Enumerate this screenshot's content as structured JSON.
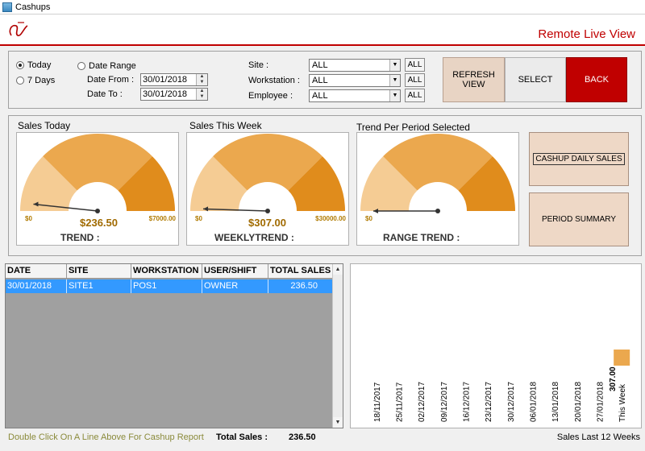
{
  "window": {
    "title": "Cashups"
  },
  "header": {
    "view_title": "Remote Live View"
  },
  "filters": {
    "today_label": "Today",
    "seven_days_label": "7 Days",
    "date_range_label": "Date Range",
    "date_from_label": "Date From :",
    "date_to_label": "Date To :",
    "date_from": "30/01/2018",
    "date_to": "30/01/2018",
    "site_label": "Site :",
    "workstation_label": "Workstation :",
    "employee_label": "Employee :",
    "site_value": "ALL",
    "workstation_value": "ALL",
    "employee_value": "ALL",
    "all_button": "ALL",
    "selected_period": "Today"
  },
  "actions": {
    "refresh_label": "REFRESH VIEW",
    "select_label": "SELECT",
    "back_label": "BACK",
    "back_color": "#c00000"
  },
  "gauges": [
    {
      "title": "Sales Today",
      "min": "$0",
      "max": "$7000.00",
      "value": "$236.50",
      "value_num": 236.5,
      "max_num": 7000,
      "trend": "TREND :"
    },
    {
      "title": "Sales This Week",
      "min": "$0",
      "max": "$30000.00",
      "value": "$307.00",
      "value_num": 307,
      "max_num": 30000,
      "trend": "WEEKLYTREND :"
    },
    {
      "title": "Trend Per Period Selected",
      "min": "$0",
      "max": "",
      "value": "",
      "value_num": 0,
      "max_num": 1,
      "trend": "RANGE TREND :"
    }
  ],
  "gauge_colors": {
    "light": "#f5cc94",
    "mid": "#eba84e",
    "dark": "#e08c1c"
  },
  "side_buttons": {
    "cashup_daily": "CASHUP DAILY SALES",
    "period_summary": "PERIOD SUMMARY"
  },
  "table": {
    "columns": [
      "DATE",
      "SITE",
      "WORKSTATION",
      "USER/SHIFT",
      "TOTAL SALES"
    ],
    "rows": [
      [
        "30/01/2018",
        "SITE1",
        "POS1",
        "OWNER",
        "236.50"
      ]
    ]
  },
  "footer": {
    "hint": "Double Click On A Line Above For Cashup Report",
    "total_label": "Total Sales :",
    "total_value": "236.50",
    "weeks_label": "Sales Last 12 Weeks"
  },
  "chart_data": {
    "type": "bar",
    "categories": [
      "18/11/2017",
      "25/11/2017",
      "02/12/2017",
      "09/12/2017",
      "16/12/2017",
      "23/12/2017",
      "30/12/2017",
      "06/01/2018",
      "13/01/2018",
      "20/01/2018",
      "27/01/2018",
      "This Week"
    ],
    "values": [
      0,
      0,
      0,
      0,
      0,
      0,
      0,
      0,
      0,
      0,
      0,
      307
    ],
    "data_labels": [
      "",
      "",
      "",
      "",
      "",
      "",
      "",
      "",
      "",
      "",
      "",
      "307.00"
    ],
    "title": "",
    "xlabel": "",
    "ylabel": ""
  }
}
